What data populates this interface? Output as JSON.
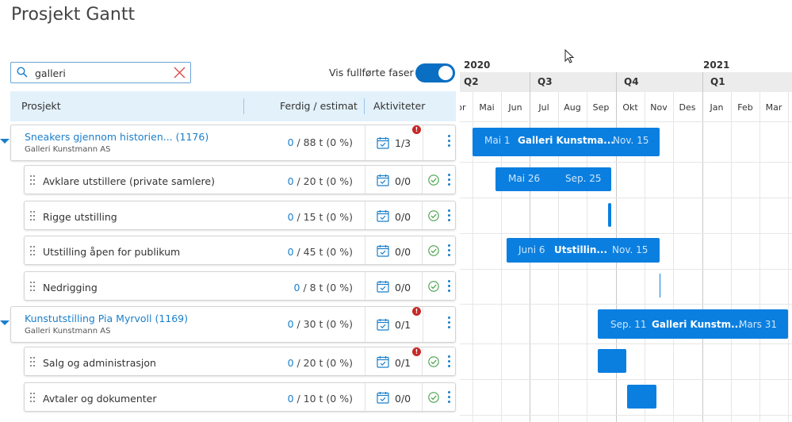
{
  "title": "Prosjekt Gantt",
  "search": {
    "value": "galleri",
    "placeholder": ""
  },
  "toggle": {
    "label": "Vis fullførte faser",
    "on": true
  },
  "table_header": {
    "project": "Prosjekt",
    "done_estimate": "Ferdig / estimat",
    "activities": "Aktiviteter"
  },
  "rows": [
    {
      "type": "project",
      "name": "Sneakers gjennom historien... (1176)",
      "client": "Galleri Kunstmann AS",
      "done": "0",
      "rest": " / 88 t  (0 %)",
      "activities": "1/3",
      "alert": "!"
    },
    {
      "type": "task",
      "name": "Avklare utstillere (private samlere)",
      "done": "0",
      "rest": " / 20 t  (0 %)",
      "activities": "0/0"
    },
    {
      "type": "task",
      "name": "Rigge utstilling",
      "done": "0",
      "rest": " / 15 t  (0 %)",
      "activities": "0/0"
    },
    {
      "type": "task",
      "name": "Utstilling åpen for publikum",
      "done": "0",
      "rest": " / 45 t  (0 %)",
      "activities": "0/0"
    },
    {
      "type": "task",
      "name": "Nedrigging",
      "done": "0",
      "rest": " / 8 t  (0 %)",
      "activities": "0/0"
    },
    {
      "type": "project",
      "name": "Kunstutstilling Pia Myrvoll (1169)",
      "client": "Galleri Kunstmann AS",
      "done": "0",
      "rest": " / 30 t  (0 %)",
      "activities": "0/1",
      "alert": "!"
    },
    {
      "type": "task",
      "name": "Salg og administrasjon",
      "done": "0",
      "rest": " / 20 t  (0 %)",
      "activities": "0/1",
      "alert": "!"
    },
    {
      "type": "task",
      "name": "Avtaler og dokumenter",
      "done": "0",
      "rest": " / 10 t  (0 %)",
      "activities": "0/0"
    }
  ],
  "gantt": {
    "years": [
      "2020",
      "2021"
    ],
    "quarters": [
      "Q2",
      "Q3",
      "Q4",
      "Q1"
    ],
    "months": [
      "Apr",
      "Mai",
      "Jun",
      "Jul",
      "Aug",
      "Sep",
      "Okt",
      "Nov",
      "Des",
      "Jan",
      "Feb",
      "Mar"
    ],
    "bars": [
      {
        "start": "Mai 1",
        "title": "Galleri Kunstma...",
        "end": "Nov. 15"
      },
      {
        "start": "Mai 26",
        "title": "",
        "end": "Sep. 25"
      },
      {
        "start": "Juni 6",
        "title": "Utstillin...",
        "end": "Nov. 15"
      },
      {
        "start": "Sep. 11",
        "title": "Galleri Kunstm...",
        "end": "Mars 31"
      }
    ]
  },
  "colors": {
    "accent": "#0a7fe0",
    "link": "#1a7fcb",
    "header_bg": "#e3f1fb",
    "alert": "#c62828",
    "check": "#43a047"
  }
}
